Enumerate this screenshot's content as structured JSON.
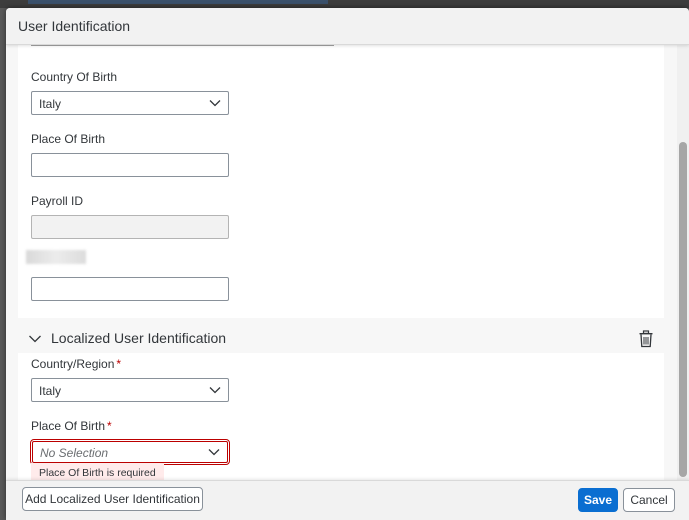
{
  "dialog": {
    "title": "User Identification"
  },
  "form": {
    "country_of_birth": {
      "label": "Country Of Birth",
      "value": "Italy"
    },
    "place_of_birth": {
      "label": "Place Of Birth",
      "value": ""
    },
    "payroll_id": {
      "label": "Payroll ID",
      "value": ""
    },
    "extra_field": {
      "value": ""
    }
  },
  "localized_section": {
    "title": "Localized User Identification",
    "country_region": {
      "label": "Country/Region",
      "required_mark": "*",
      "value": "Italy"
    },
    "place_of_birth": {
      "label": "Place Of Birth",
      "required_mark": "*",
      "placeholder": "No Selection",
      "error": "Place Of Birth is required"
    }
  },
  "footer": {
    "add_label": "Add Localized User Identification",
    "save_label": "Save",
    "cancel_label": "Cancel"
  },
  "colors": {
    "accent": "#0a6ed1",
    "error": "#bb0000",
    "error_bg": "#ffebeb"
  },
  "icons": {
    "dropdown": "chevron-down-icon",
    "section_toggle": "chevron-down-icon",
    "delete": "trash-icon"
  }
}
